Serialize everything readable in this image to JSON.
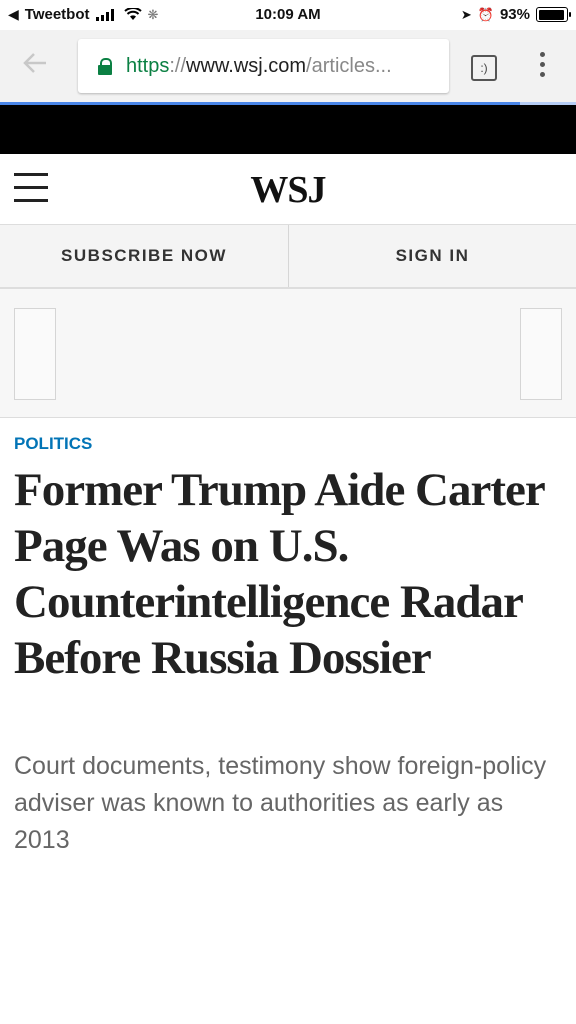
{
  "status_bar": {
    "back_app": "Tweetbot",
    "time": "10:09 AM",
    "battery": "93%",
    "battery_level": 0.93,
    "icons": [
      "back-arrow-icon",
      "cellular-signal-icon",
      "wifi-icon",
      "activity-spinner-icon",
      "location-arrow-icon",
      "alarm-icon",
      "battery-icon"
    ]
  },
  "browser": {
    "url_scheme": "https",
    "url_separator": "://",
    "url_host": "www.wsj.com",
    "url_path": "/articles...",
    "tab_count": ":)",
    "accent": "#4a86e8",
    "secure_color": "#0b8043"
  },
  "site": {
    "logo": "WSJ",
    "subscribe_label": "SUBSCRIBE NOW",
    "signin_label": "SIGN IN"
  },
  "article": {
    "category": "POLITICS",
    "category_color": "#0274b6",
    "headline": "Former Trump Aide Carter Page Was on U.S. Counterintelligence Radar Before Russia Dossier",
    "dek": "Court documents, testimony show foreign-policy adviser was known to authorities as early as 2013"
  }
}
